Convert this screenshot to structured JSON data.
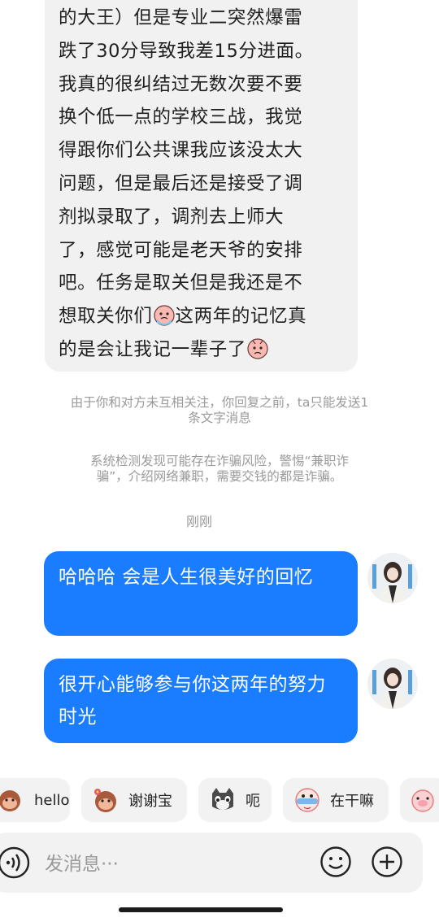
{
  "incoming_message": {
    "lines": [
      "的大王）但是专业二突然爆雷",
      "跌了30分导致我差15分进面。",
      "我真的很纠结过无数次要不要",
      "换个低一点的学校三战，我觉",
      "得跟你们公共课我应该没太大",
      "问题，但是最后还是接受了调",
      "剂拟录取了，调剂去上师大",
      "了，感觉可能是老天爷的安排",
      "吧。任务是取关但是我还是不",
      "想取关你们",
      "这两年的记忆真",
      "的是会让我记一辈子了"
    ]
  },
  "system_notices": {
    "follow_limit": [
      "由于你和对方未互相关注，你回复之前，ta只能发送1",
      "条文字消息"
    ],
    "fraud_warning": [
      "系统检测发现可能存在诈骗风险，警惕“兼职诈",
      "骗”，介绍网络兼职，需要交钱的都是诈骗。"
    ]
  },
  "timestamp": "刚刚",
  "outgoing_messages": [
    {
      "text": "哈哈哈 会是人生很美好的回忆"
    },
    {
      "text": "很开心能够参与你这两年的努力时光"
    }
  ],
  "quick_replies": [
    {
      "label": "hello",
      "icon": "monkey-icon"
    },
    {
      "label": "谢谢宝",
      "icon": "monkey-flower-icon"
    },
    {
      "label": "呃",
      "icon": "cat-icon"
    },
    {
      "label": "在干嘛",
      "icon": "peek-icon"
    }
  ],
  "input": {
    "placeholder": "发消息···"
  },
  "colors": {
    "accent": "#1a7cff",
    "bubble_in": "#f1f1f1",
    "notice": "#9a9a9a"
  }
}
